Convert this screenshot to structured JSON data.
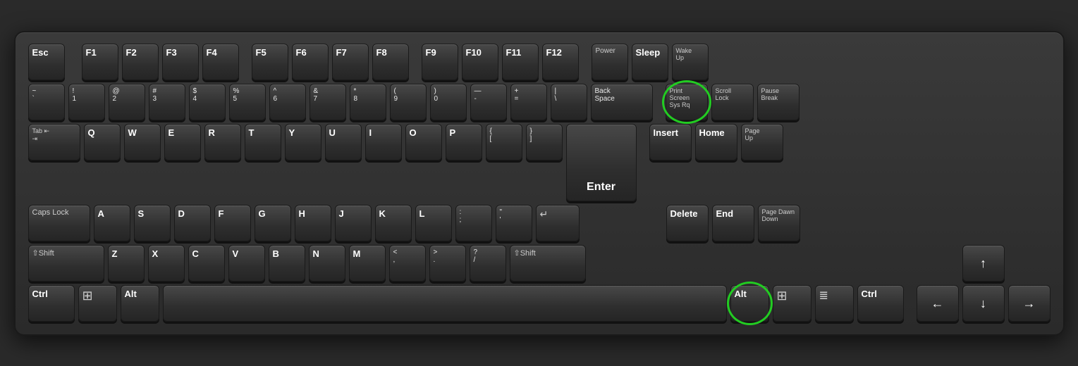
{
  "keyboard": {
    "rows": {
      "row0": {
        "keys": [
          {
            "id": "esc",
            "top": "Esc",
            "bottom": "",
            "w": "esc"
          },
          {
            "id": "f1",
            "top": "F1",
            "bottom": "",
            "w": "fn"
          },
          {
            "id": "f2",
            "top": "F2",
            "bottom": "",
            "w": "fn"
          },
          {
            "id": "f3",
            "top": "F3",
            "bottom": "",
            "w": "fn"
          },
          {
            "id": "f4",
            "top": "F4",
            "bottom": "",
            "w": "fn"
          },
          {
            "id": "f5",
            "top": "F5",
            "bottom": "",
            "w": "fn"
          },
          {
            "id": "f6",
            "top": "F6",
            "bottom": "",
            "w": "fn"
          },
          {
            "id": "f7",
            "top": "F7",
            "bottom": "",
            "w": "fn"
          },
          {
            "id": "f8",
            "top": "F8",
            "bottom": "",
            "w": "fn"
          },
          {
            "id": "f9",
            "top": "F9",
            "bottom": "",
            "w": "fn"
          },
          {
            "id": "f10",
            "top": "F10",
            "bottom": "",
            "w": "fn"
          },
          {
            "id": "f11",
            "top": "F11",
            "bottom": "",
            "w": "fn"
          },
          {
            "id": "f12",
            "top": "F12",
            "bottom": "",
            "w": "fn"
          },
          {
            "id": "power",
            "top": "Power",
            "bottom": "",
            "w": "fn"
          },
          {
            "id": "sleep",
            "top": "Sleep",
            "bottom": "",
            "w": "fn"
          },
          {
            "id": "wakeup",
            "top": "Wake",
            "bottom": "Up",
            "w": "fn"
          }
        ]
      }
    },
    "highlighted": [
      "print-screen",
      "right-alt"
    ],
    "caps_lock_label": "Caps Lock",
    "page_dawn_label": "Page Dawn"
  }
}
